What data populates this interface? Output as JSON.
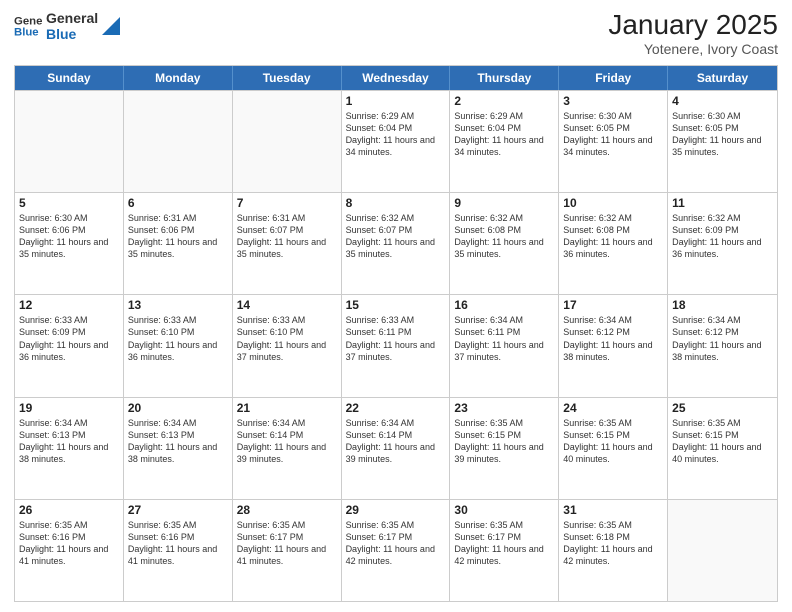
{
  "logo": {
    "line1": "General",
    "line2": "Blue"
  },
  "title": "January 2025",
  "subtitle": "Yotenere, Ivory Coast",
  "weekdays": [
    "Sunday",
    "Monday",
    "Tuesday",
    "Wednesday",
    "Thursday",
    "Friday",
    "Saturday"
  ],
  "rows": [
    [
      {
        "day": "",
        "sunrise": "",
        "sunset": "",
        "daylight": ""
      },
      {
        "day": "",
        "sunrise": "",
        "sunset": "",
        "daylight": ""
      },
      {
        "day": "",
        "sunrise": "",
        "sunset": "",
        "daylight": ""
      },
      {
        "day": "1",
        "sunrise": "Sunrise: 6:29 AM",
        "sunset": "Sunset: 6:04 PM",
        "daylight": "Daylight: 11 hours and 34 minutes."
      },
      {
        "day": "2",
        "sunrise": "Sunrise: 6:29 AM",
        "sunset": "Sunset: 6:04 PM",
        "daylight": "Daylight: 11 hours and 34 minutes."
      },
      {
        "day": "3",
        "sunrise": "Sunrise: 6:30 AM",
        "sunset": "Sunset: 6:05 PM",
        "daylight": "Daylight: 11 hours and 34 minutes."
      },
      {
        "day": "4",
        "sunrise": "Sunrise: 6:30 AM",
        "sunset": "Sunset: 6:05 PM",
        "daylight": "Daylight: 11 hours and 35 minutes."
      }
    ],
    [
      {
        "day": "5",
        "sunrise": "Sunrise: 6:30 AM",
        "sunset": "Sunset: 6:06 PM",
        "daylight": "Daylight: 11 hours and 35 minutes."
      },
      {
        "day": "6",
        "sunrise": "Sunrise: 6:31 AM",
        "sunset": "Sunset: 6:06 PM",
        "daylight": "Daylight: 11 hours and 35 minutes."
      },
      {
        "day": "7",
        "sunrise": "Sunrise: 6:31 AM",
        "sunset": "Sunset: 6:07 PM",
        "daylight": "Daylight: 11 hours and 35 minutes."
      },
      {
        "day": "8",
        "sunrise": "Sunrise: 6:32 AM",
        "sunset": "Sunset: 6:07 PM",
        "daylight": "Daylight: 11 hours and 35 minutes."
      },
      {
        "day": "9",
        "sunrise": "Sunrise: 6:32 AM",
        "sunset": "Sunset: 6:08 PM",
        "daylight": "Daylight: 11 hours and 35 minutes."
      },
      {
        "day": "10",
        "sunrise": "Sunrise: 6:32 AM",
        "sunset": "Sunset: 6:08 PM",
        "daylight": "Daylight: 11 hours and 36 minutes."
      },
      {
        "day": "11",
        "sunrise": "Sunrise: 6:32 AM",
        "sunset": "Sunset: 6:09 PM",
        "daylight": "Daylight: 11 hours and 36 minutes."
      }
    ],
    [
      {
        "day": "12",
        "sunrise": "Sunrise: 6:33 AM",
        "sunset": "Sunset: 6:09 PM",
        "daylight": "Daylight: 11 hours and 36 minutes."
      },
      {
        "day": "13",
        "sunrise": "Sunrise: 6:33 AM",
        "sunset": "Sunset: 6:10 PM",
        "daylight": "Daylight: 11 hours and 36 minutes."
      },
      {
        "day": "14",
        "sunrise": "Sunrise: 6:33 AM",
        "sunset": "Sunset: 6:10 PM",
        "daylight": "Daylight: 11 hours and 37 minutes."
      },
      {
        "day": "15",
        "sunrise": "Sunrise: 6:33 AM",
        "sunset": "Sunset: 6:11 PM",
        "daylight": "Daylight: 11 hours and 37 minutes."
      },
      {
        "day": "16",
        "sunrise": "Sunrise: 6:34 AM",
        "sunset": "Sunset: 6:11 PM",
        "daylight": "Daylight: 11 hours and 37 minutes."
      },
      {
        "day": "17",
        "sunrise": "Sunrise: 6:34 AM",
        "sunset": "Sunset: 6:12 PM",
        "daylight": "Daylight: 11 hours and 38 minutes."
      },
      {
        "day": "18",
        "sunrise": "Sunrise: 6:34 AM",
        "sunset": "Sunset: 6:12 PM",
        "daylight": "Daylight: 11 hours and 38 minutes."
      }
    ],
    [
      {
        "day": "19",
        "sunrise": "Sunrise: 6:34 AM",
        "sunset": "Sunset: 6:13 PM",
        "daylight": "Daylight: 11 hours and 38 minutes."
      },
      {
        "day": "20",
        "sunrise": "Sunrise: 6:34 AM",
        "sunset": "Sunset: 6:13 PM",
        "daylight": "Daylight: 11 hours and 38 minutes."
      },
      {
        "day": "21",
        "sunrise": "Sunrise: 6:34 AM",
        "sunset": "Sunset: 6:14 PM",
        "daylight": "Daylight: 11 hours and 39 minutes."
      },
      {
        "day": "22",
        "sunrise": "Sunrise: 6:34 AM",
        "sunset": "Sunset: 6:14 PM",
        "daylight": "Daylight: 11 hours and 39 minutes."
      },
      {
        "day": "23",
        "sunrise": "Sunrise: 6:35 AM",
        "sunset": "Sunset: 6:15 PM",
        "daylight": "Daylight: 11 hours and 39 minutes."
      },
      {
        "day": "24",
        "sunrise": "Sunrise: 6:35 AM",
        "sunset": "Sunset: 6:15 PM",
        "daylight": "Daylight: 11 hours and 40 minutes."
      },
      {
        "day": "25",
        "sunrise": "Sunrise: 6:35 AM",
        "sunset": "Sunset: 6:15 PM",
        "daylight": "Daylight: 11 hours and 40 minutes."
      }
    ],
    [
      {
        "day": "26",
        "sunrise": "Sunrise: 6:35 AM",
        "sunset": "Sunset: 6:16 PM",
        "daylight": "Daylight: 11 hours and 41 minutes."
      },
      {
        "day": "27",
        "sunrise": "Sunrise: 6:35 AM",
        "sunset": "Sunset: 6:16 PM",
        "daylight": "Daylight: 11 hours and 41 minutes."
      },
      {
        "day": "28",
        "sunrise": "Sunrise: 6:35 AM",
        "sunset": "Sunset: 6:17 PM",
        "daylight": "Daylight: 11 hours and 41 minutes."
      },
      {
        "day": "29",
        "sunrise": "Sunrise: 6:35 AM",
        "sunset": "Sunset: 6:17 PM",
        "daylight": "Daylight: 11 hours and 42 minutes."
      },
      {
        "day": "30",
        "sunrise": "Sunrise: 6:35 AM",
        "sunset": "Sunset: 6:17 PM",
        "daylight": "Daylight: 11 hours and 42 minutes."
      },
      {
        "day": "31",
        "sunrise": "Sunrise: 6:35 AM",
        "sunset": "Sunset: 6:18 PM",
        "daylight": "Daylight: 11 hours and 42 minutes."
      },
      {
        "day": "",
        "sunrise": "",
        "sunset": "",
        "daylight": ""
      }
    ]
  ]
}
